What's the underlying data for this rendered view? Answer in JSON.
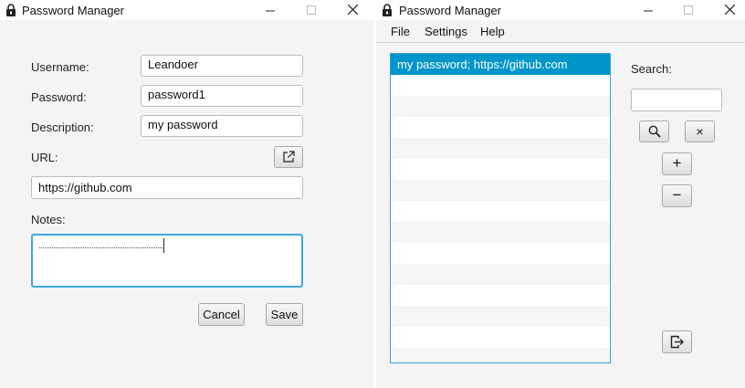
{
  "editor_window": {
    "title": "Password Manager",
    "controls": {
      "minimize": "—",
      "maximize": "☐",
      "close": "✕"
    },
    "form": {
      "username_label": "Username:",
      "username_value": "Leandoer",
      "password_label": "Password:",
      "password_value": "password1",
      "description_label": "Description:",
      "description_value": "my password",
      "url_label": "URL:",
      "url_value": "https://github.com",
      "notes_label": "Notes:",
      "notes_value": ""
    },
    "buttons": {
      "cancel": "Cancel",
      "save": "Save"
    },
    "icons": {
      "open_url": "external-link-icon",
      "app": "lock-icon"
    }
  },
  "list_window": {
    "title": "Password Manager",
    "controls": {
      "minimize": "—",
      "maximize": "☐",
      "close": "✕"
    },
    "menu": [
      "File",
      "Settings",
      "Help"
    ],
    "entries": [
      "my password; https://github.com"
    ],
    "selected_index": 0,
    "search": {
      "label": "Search:",
      "value": ""
    },
    "buttons": {
      "clear": "×",
      "add": "+",
      "remove": "−"
    },
    "icons": {
      "search": "search-icon",
      "logout": "logout-icon",
      "app": "lock-icon"
    }
  },
  "colors": {
    "accent": "#3ca7dc",
    "selection": "#0096c9",
    "window_bg": "#f4f4f4"
  }
}
